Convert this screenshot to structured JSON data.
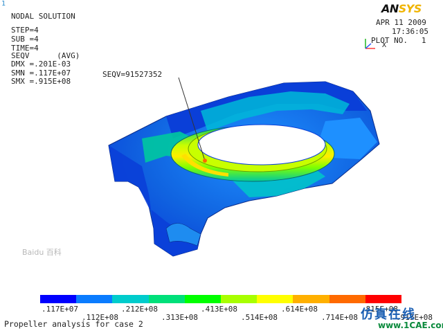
{
  "window_number": "1",
  "title": "NODAL SOLUTION",
  "info_lines": [
    "STEP=4",
    "SUB =4",
    "TIME=4",
    "SEQV      (AVG)",
    "DMX =.201E-03",
    "SMN =.117E+07",
    "SMX =.915E+08"
  ],
  "annotation": "SEQV=91527352",
  "logo": {
    "main": "AN",
    "accent": "SYS"
  },
  "date": "APR 11 2009",
  "time": "17:36:05",
  "plot_no": "PLOT NO.   1",
  "triad": {
    "x_label": "X"
  },
  "legend": {
    "colors": [
      "#0000ff",
      "#0a7cff",
      "#00cccc",
      "#00e07a",
      "#00ff00",
      "#a8ff00",
      "#ffff00",
      "#ffb000",
      "#ff6a00",
      "#ff0000"
    ],
    "ticks_top": [
      ".117E+07",
      ".212E+08",
      ".413E+08",
      ".614E+08",
      ".815E+08"
    ],
    "ticks_bottom": [
      ".112E+08",
      ".313E+08",
      ".514E+08",
      ".714E+08",
      ".915E+08"
    ]
  },
  "footer": "Propeller analysis for case 2",
  "watermark": {
    "brand": "仿真在线",
    "url": "www.1CAE.com",
    "left": "Baidu 百科"
  }
}
